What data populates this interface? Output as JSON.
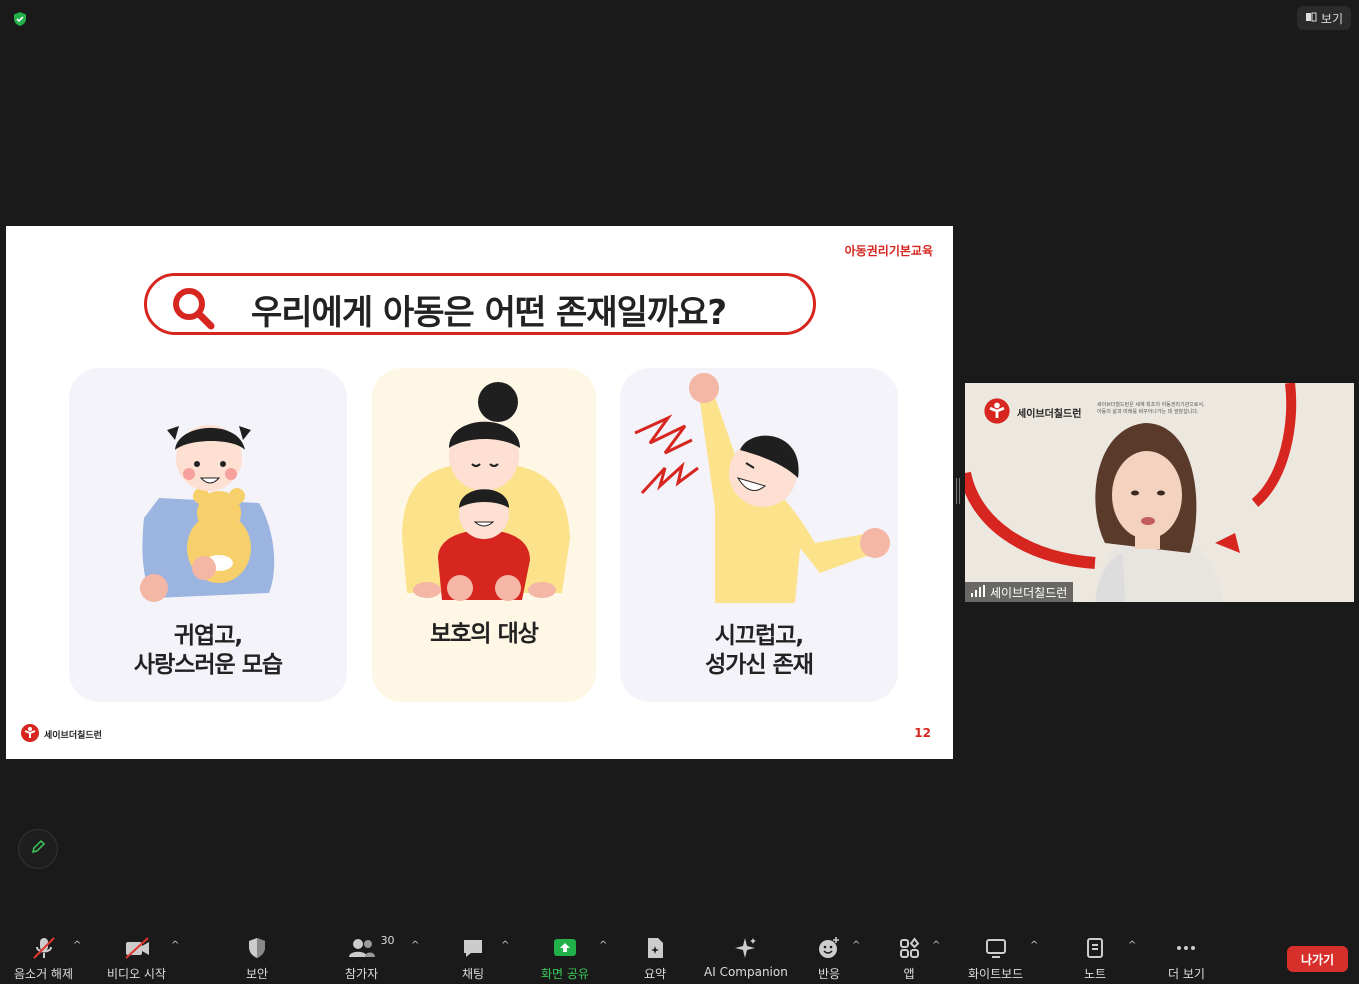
{
  "top": {
    "view_label": "보기"
  },
  "slide": {
    "tag": "아동권리기본교육",
    "title": "우리에게 아동은 어떤 존재일까요?",
    "cards": [
      {
        "line1": "귀엽고,",
        "line2": "사랑스러운 모습"
      },
      {
        "line1": "보호의 대상",
        "line2": ""
      },
      {
        "line1": "시끄럽고,",
        "line2": "성가신 존재"
      }
    ],
    "logo_text": "세이브더칠드런",
    "page_number": "12"
  },
  "video": {
    "participant_name": "세이브더칠드런",
    "banner_logo": "세이브더칠드런",
    "banner_line1": "세이브더칠드런은 세계 최초의 아동권리기관으로서,",
    "banner_line2": "아동의 삶과 미래를 바꾸어나가는 데 앞장섭니다."
  },
  "toolbar": {
    "mute": "음소거 해제",
    "video": "비디오 시작",
    "security": "보안",
    "participants": "참가자",
    "participants_count": "30",
    "chat": "채팅",
    "share": "화면 공유",
    "summary": "요약",
    "ai": "AI Companion",
    "reactions": "반응",
    "apps": "앱",
    "whiteboard": "화이트보드",
    "notes": "노트",
    "more": "더 보기",
    "leave": "나가기"
  },
  "colors": {
    "accent_red": "#d6261f",
    "share_green": "#3ccb5a",
    "leave_red": "#d7302a"
  }
}
